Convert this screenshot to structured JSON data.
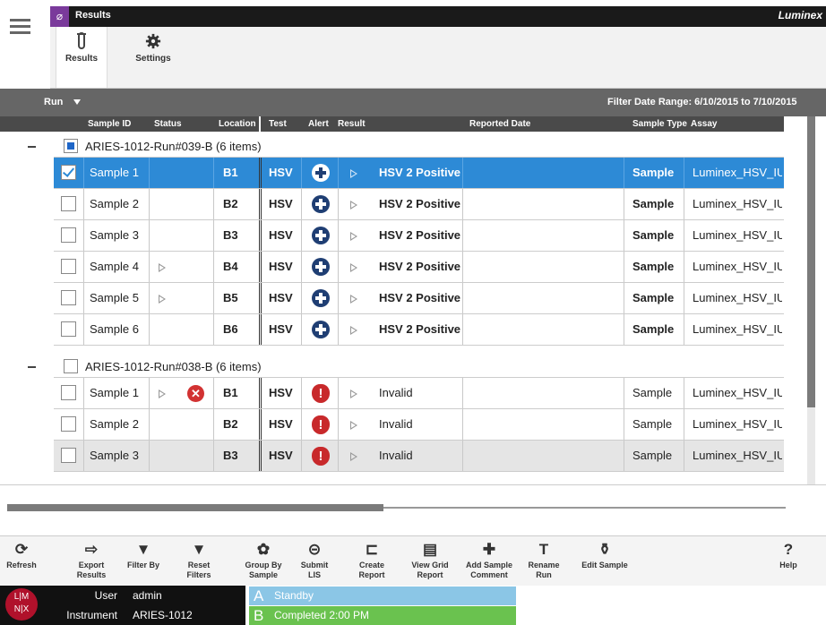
{
  "app": {
    "title": "Results",
    "brand": "Luminex"
  },
  "modules": [
    {
      "label": "Results",
      "icon": "test-tube-icon"
    },
    {
      "label": "Settings",
      "icon": "gear-icon"
    }
  ],
  "run_bar": {
    "label": "Run",
    "filter_range": "Filter Date Range: 6/10/2015 to 7/10/2015"
  },
  "columns": [
    "Sample ID",
    "Status",
    "Location",
    "Test",
    "Alert",
    "Result",
    "Reported Date",
    "Sample Type",
    "Assay"
  ],
  "groups": [
    {
      "label": "ARIES-1012-Run#039-B (6 items)",
      "rows": [
        {
          "sample": "Sample 1",
          "status_tri": false,
          "location": "B1",
          "test": "HSV",
          "result": "HSV 2 Positive",
          "sample_type": "Sample",
          "assay": "Luminex_HSV_IU",
          "selected": true
        },
        {
          "sample": "Sample 2",
          "status_tri": false,
          "location": "B2",
          "test": "HSV",
          "result": "HSV 2 Positive",
          "sample_type": "Sample",
          "assay": "Luminex_HSV_IU"
        },
        {
          "sample": "Sample 3",
          "status_tri": false,
          "location": "B3",
          "test": "HSV",
          "result": "HSV 2 Positive",
          "sample_type": "Sample",
          "assay": "Luminex_HSV_IU"
        },
        {
          "sample": "Sample 4",
          "status_tri": true,
          "location": "B4",
          "test": "HSV",
          "result": "HSV 2 Positive",
          "sample_type": "Sample",
          "assay": "Luminex_HSV_IU"
        },
        {
          "sample": "Sample 5",
          "status_tri": true,
          "location": "B5",
          "test": "HSV",
          "result": "HSV 2 Positive",
          "sample_type": "Sample",
          "assay": "Luminex_HSV_IU"
        },
        {
          "sample": "Sample 6",
          "status_tri": false,
          "location": "B6",
          "test": "HSV",
          "result": "HSV 2 Positive",
          "sample_type": "Sample",
          "assay": "Luminex_HSV_IU"
        }
      ]
    },
    {
      "label": "ARIES-1012-Run#038-B (6 items)",
      "rows": [
        {
          "sample": "Sample 1",
          "status_tri": true,
          "location": "B1",
          "test": "HSV",
          "result": "Invalid",
          "sample_type": "Sample",
          "assay": "Luminex_HSV_IU"
        },
        {
          "sample": "Sample 2",
          "status_tri": false,
          "location": "B2",
          "test": "HSV",
          "result": "Invalid",
          "sample_type": "Sample",
          "assay": "Luminex_HSV_IU"
        },
        {
          "sample": "Sample 3",
          "status_tri": false,
          "location": "B3",
          "test": "HSV",
          "result": "Invalid",
          "sample_type": "Sample",
          "assay": "Luminex_HSV_IU"
        }
      ]
    }
  ],
  "toolbar": [
    {
      "label": "Refresh",
      "icon": "refresh-icon"
    },
    {
      "label": "Export Results",
      "icon": "export-icon"
    },
    {
      "label": "Filter By",
      "icon": "filter-icon"
    },
    {
      "label": "Reset Filters",
      "icon": "reset-filter-icon"
    },
    {
      "label": "Group By Sample",
      "icon": "group-icon"
    },
    {
      "label": "Submit LIS",
      "icon": "submit-lis-icon"
    },
    {
      "label": "Create Report",
      "icon": "create-report-icon"
    },
    {
      "label": "View Grid Report",
      "icon": "grid-report-icon"
    },
    {
      "label": "Add Sample Comment",
      "icon": "add-comment-icon"
    },
    {
      "label": "Rename Run",
      "icon": "rename-icon"
    },
    {
      "label": "Edit Sample",
      "icon": "edit-sample-icon"
    },
    {
      "label": "Help",
      "icon": "help-icon"
    }
  ],
  "status_bar": {
    "logo": "LMNX",
    "user_label": "User",
    "user_value": "admin",
    "instrument_label": "Instrument",
    "instrument_value": "ARIES-1012",
    "module_a": {
      "letter": "A",
      "text": "Standby",
      "color": "#8bc6e6"
    },
    "module_b": {
      "letter": "B",
      "text": "Completed   2:00 PM",
      "color": "#6ac24f"
    }
  }
}
